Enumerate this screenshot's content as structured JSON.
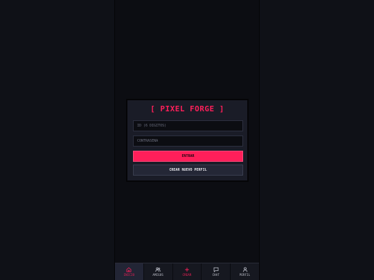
{
  "app": {
    "title": "[ PIXEL FORGE ]",
    "accent_color": "#ff1f5a",
    "background_color": "#0f1117",
    "card_color": "#1a1c27"
  },
  "login": {
    "id_placeholder": "ID (6 DÍGITOS)",
    "password_placeholder": "CONTRASEÑA",
    "submit_label": "ENTRAR",
    "create_profile_label": "CREAR NUEVO PERFIL"
  },
  "nav": {
    "items": [
      {
        "label": "INICIO",
        "icon": "home-icon",
        "active": true
      },
      {
        "label": "AMIGOS",
        "icon": "friends-icon",
        "active": false
      },
      {
        "label": "CREAR",
        "icon": "plus-icon",
        "active": false
      },
      {
        "label": "CHAT",
        "icon": "chat-icon",
        "active": false
      },
      {
        "label": "PERFIL",
        "icon": "user-icon",
        "active": false
      }
    ]
  }
}
